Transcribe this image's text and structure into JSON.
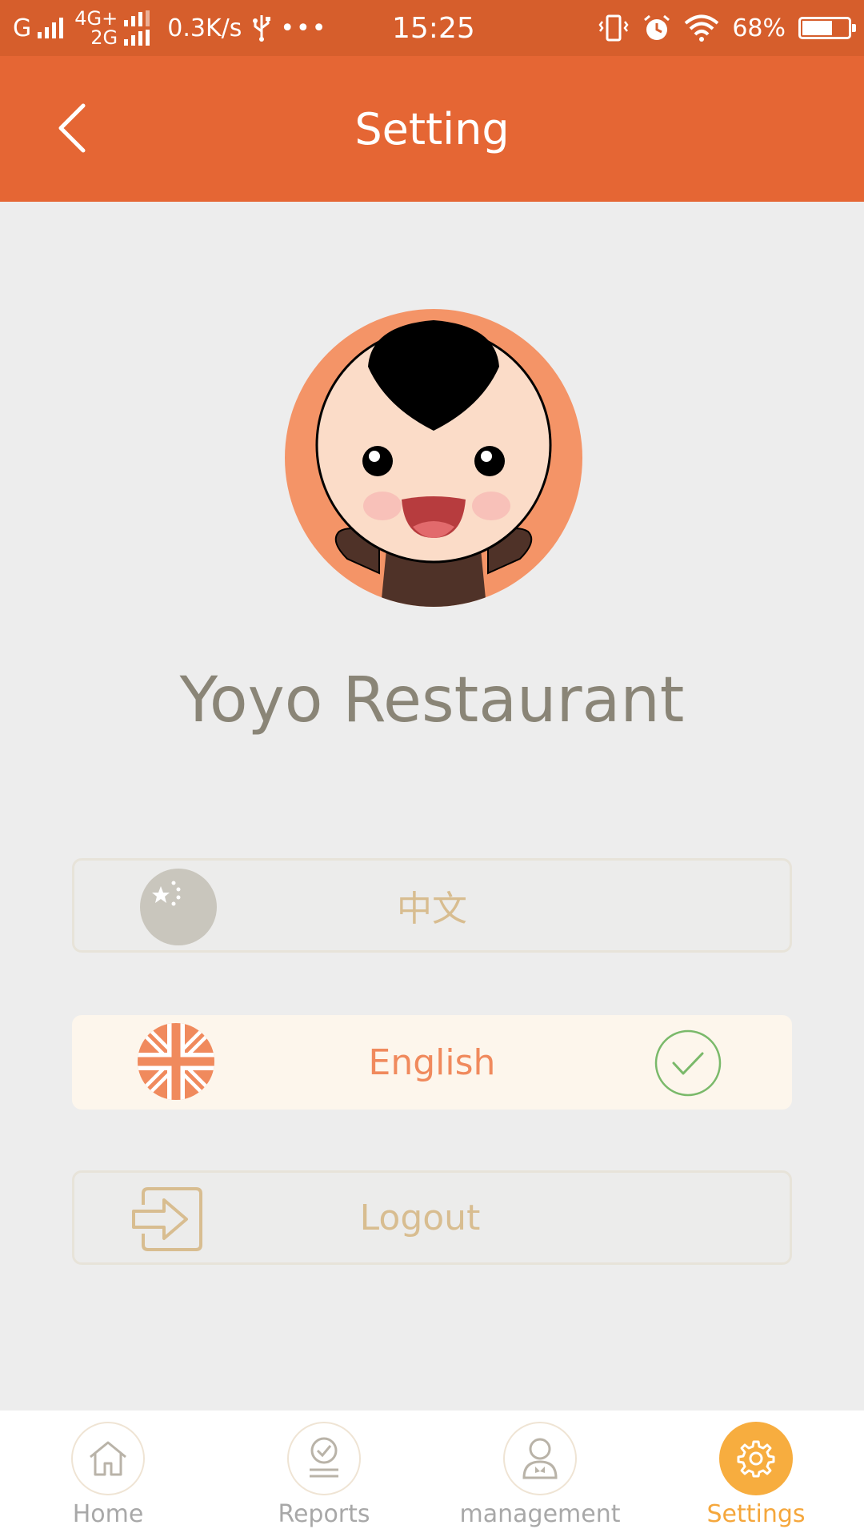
{
  "status_bar": {
    "carrier1": "G",
    "network_top": "4G+",
    "network_bottom": "2G",
    "speed": "0.3K/s",
    "dots": "•••",
    "time": "15:25",
    "battery": "68%",
    "battery_level": 0.68,
    "icons": [
      "signal-icon",
      "usb-icon",
      "vibrate-icon",
      "alarm-icon",
      "wifi-icon",
      "battery-charging-icon"
    ]
  },
  "header": {
    "title": "Setting",
    "back_icon": "chevron-left-icon"
  },
  "profile": {
    "name": "Yoyo Restaurant",
    "avatar_icon": "cartoon-boy-avatar"
  },
  "options": [
    {
      "label": "中文",
      "icon": "china-flag-icon",
      "selected": false
    },
    {
      "label": "English",
      "icon": "uk-flag-icon",
      "selected": true
    },
    {
      "label": "Logout",
      "icon": "logout-icon",
      "selected": false
    }
  ],
  "tabs": [
    {
      "label": "Home",
      "icon": "home-icon",
      "active": false
    },
    {
      "label": "Reports",
      "icon": "reports-icon",
      "active": false
    },
    {
      "label": "management",
      "icon": "management-icon",
      "active": false
    },
    {
      "label": "Settings",
      "icon": "gear-icon",
      "active": true
    }
  ],
  "colors": {
    "status_bar": "#d65e2c",
    "header": "#e56634",
    "background": "#ededed",
    "accent_orange": "#f0875a",
    "tab_active": "#f7ad3f",
    "muted_gold": "#d8bd90",
    "check_green": "#7ab96a"
  }
}
